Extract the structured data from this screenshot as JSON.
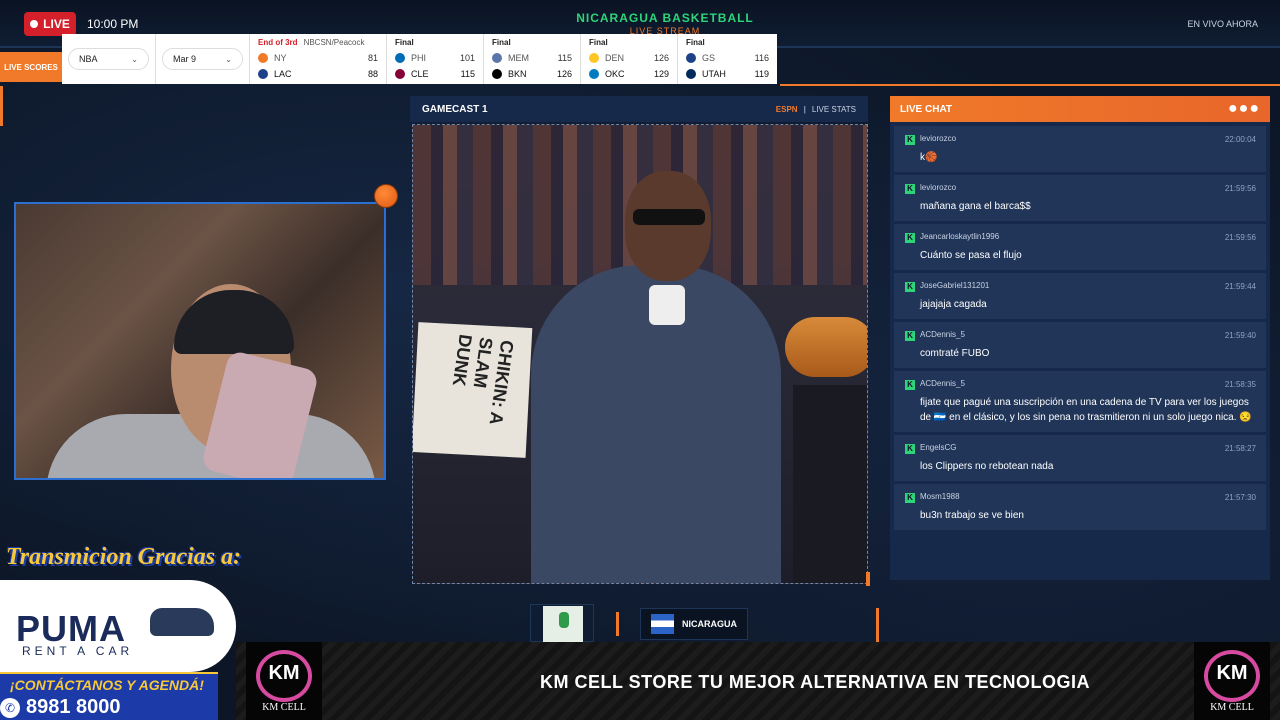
{
  "topbar": {
    "live_label": "LIVE",
    "clock": "10:00 PM",
    "brand_title": "NICARAGUA BASKETBALL",
    "brand_sub": "LIVE STREAM",
    "status": "EN VIVO AHORA"
  },
  "scores": {
    "tab_label": "LIVE SCORES",
    "league": "NBA",
    "date": "Mar 9",
    "games": [
      {
        "status": "End of 3rd",
        "network": "NBCSN/Peacock",
        "away": {
          "abbr": "NY",
          "score": "81",
          "color": "#f07a2a"
        },
        "home": {
          "abbr": "LAC",
          "score": "88",
          "color": "#1d428a"
        }
      },
      {
        "status": "Final",
        "network": "",
        "away": {
          "abbr": "PHI",
          "score": "101",
          "color": "#006bb6"
        },
        "home": {
          "abbr": "CLE",
          "score": "115",
          "color": "#860038"
        }
      },
      {
        "status": "Final",
        "network": "",
        "away": {
          "abbr": "MEM",
          "score": "115",
          "color": "#5d76a9"
        },
        "home": {
          "abbr": "BKN",
          "score": "126",
          "color": "#000000"
        }
      },
      {
        "status": "Final",
        "network": "",
        "away": {
          "abbr": "DEN",
          "score": "126",
          "color": "#fec524"
        },
        "home": {
          "abbr": "OKC",
          "score": "129",
          "color": "#007ac1"
        }
      },
      {
        "status": "Final",
        "network": "",
        "away": {
          "abbr": "GS",
          "score": "116",
          "color": "#1d428a"
        },
        "home": {
          "abbr": "UTAH",
          "score": "119",
          "color": "#002b5c"
        }
      }
    ]
  },
  "sponsor": {
    "title": "Transmicion Gracias a:",
    "brand": "PUMA",
    "brand_sub": "RENT A CAR",
    "contact": "¡CONTÁCTANOS Y AGENDÁ!",
    "phone": "8981 8000"
  },
  "gamecast": {
    "title": "GAMECAST 1",
    "source": "ESPN",
    "separator": "|",
    "stats_link": "LIVE STATS",
    "sign_text": "CHIKIN: A SLAM DUNK"
  },
  "chips": {
    "country": "NICARAGUA"
  },
  "chat": {
    "title": "LIVE CHAT",
    "messages": [
      {
        "user": "leviorozco",
        "time": "22:00:04",
        "text": "k🏀"
      },
      {
        "user": "leviorozco",
        "time": "21:59:56",
        "text": "mañana gana el barca$$"
      },
      {
        "user": "Jeancarloskaytlin1996",
        "time": "21:59:56",
        "text": "Cuánto se pasa el flujo"
      },
      {
        "user": "JoseGabriel131201",
        "time": "21:59:44",
        "text": "jajajaja cagada"
      },
      {
        "user": "ACDennis_5",
        "time": "21:59:40",
        "text": "comtraté FUBO"
      },
      {
        "user": "ACDennis_5",
        "time": "21:58:35",
        "text": "fijate que pagué una suscripción en una cadena de TV para ver los juegos de 🇳🇮 en el clásico, y los sin pena no trasmitieron ni un solo juego nica. 😒"
      },
      {
        "user": "EngelsCG",
        "time": "21:58:27",
        "text": "los Clippers no rebotean nada"
      },
      {
        "user": "Mosm1988",
        "time": "21:57:30",
        "text": "bu3n trabajo se ve bien"
      }
    ]
  },
  "bottom": {
    "km_letters": "KM",
    "km_name": "KM CELL",
    "ticker": "KM CELL STORE TU MEJOR ALTERNATIVA EN TECNOLOGIA"
  }
}
